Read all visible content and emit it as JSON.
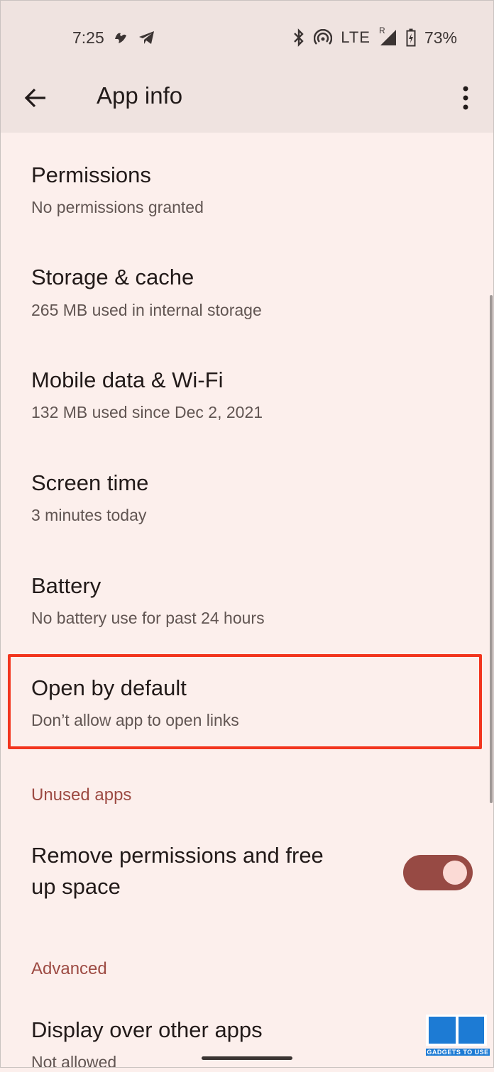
{
  "status_bar": {
    "time": "7:25",
    "network": "LTE",
    "roaming_indicator": "R",
    "battery": "73%",
    "icons": [
      "app-notification-icon",
      "telegram-icon",
      "bluetooth-icon",
      "hotspot-icon",
      "signal-icon",
      "battery-charging-icon"
    ]
  },
  "app_bar": {
    "title": "App info",
    "back_icon": "arrow-back-icon",
    "more_icon": "more-vert-icon"
  },
  "items": [
    {
      "title": "Permissions",
      "subtitle": "No permissions granted"
    },
    {
      "title": "Storage & cache",
      "subtitle": "265 MB used in internal storage"
    },
    {
      "title": "Mobile data & Wi-Fi",
      "subtitle": "132 MB used since Dec 2, 2021"
    },
    {
      "title": "Screen time",
      "subtitle": "3 minutes today"
    },
    {
      "title": "Battery",
      "subtitle": "No battery use for past 24 hours"
    },
    {
      "title": "Open by default",
      "subtitle": "Don’t allow app to open links"
    }
  ],
  "unused_apps": {
    "header": "Unused apps",
    "setting_line1": "Remove permissions and free",
    "setting_line2": "up space",
    "toggle_on": true
  },
  "advanced": {
    "header": "Advanced",
    "item_title": "Display over other apps",
    "item_subtitle": "Not allowed"
  },
  "watermark": {
    "text": "GADGETS TO USE"
  },
  "colors": {
    "background": "#fcefec",
    "app_bar": "#efe3e0",
    "accent": "#9d4b43",
    "highlight": "#f2351e",
    "toggle_track": "#974a44"
  }
}
